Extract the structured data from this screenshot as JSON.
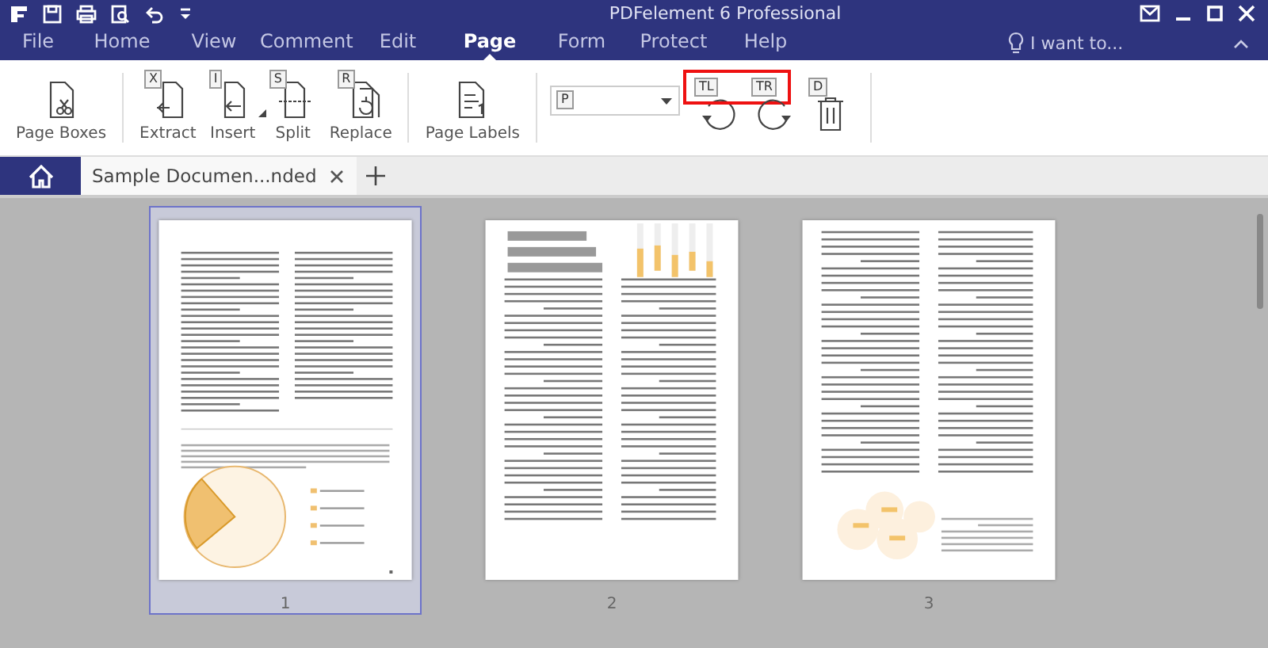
{
  "window": {
    "title": "PDFelement 6 Professional"
  },
  "menu_tabs": [
    {
      "label": "File",
      "selected": false
    },
    {
      "label": "Home",
      "selected": false
    },
    {
      "label": "View",
      "selected": false
    },
    {
      "label": "Comment",
      "selected": false
    },
    {
      "label": "Edit",
      "selected": false
    },
    {
      "label": "Page",
      "selected": true
    },
    {
      "label": "Form",
      "selected": false
    },
    {
      "label": "Protect",
      "selected": false
    },
    {
      "label": "Help",
      "selected": false
    }
  ],
  "search": {
    "placeholder": "I want to..."
  },
  "ribbon": [
    {
      "kind": "tool",
      "label": "Page Boxes"
    },
    {
      "kind": "sep"
    },
    {
      "kind": "tool",
      "label": "Extract",
      "key": "X"
    },
    {
      "kind": "tool",
      "label": "Insert",
      "key": "I",
      "menu": true
    },
    {
      "kind": "tool",
      "label": "Split",
      "key": "S"
    },
    {
      "kind": "tool",
      "label": "Replace",
      "key": "R"
    },
    {
      "kind": "sep"
    },
    {
      "kind": "tool",
      "label": "Page Labels"
    },
    {
      "kind": "sep"
    },
    {
      "kind": "dropdown",
      "key": "P"
    },
    {
      "kind": "icon",
      "key": "TL",
      "highlighted": true
    },
    {
      "kind": "icon",
      "key": "TR",
      "highlighted": true
    },
    {
      "kind": "icon",
      "key": "D"
    },
    {
      "kind": "sep"
    }
  ],
  "doc_tabs": [
    {
      "label": "Sample Documen...nded",
      "selected": true
    }
  ],
  "pages": [
    {
      "label": "1",
      "selected": true,
      "rotated": false
    },
    {
      "label": "2",
      "selected": false,
      "rotated": true
    },
    {
      "label": "3",
      "selected": false,
      "rotated": true
    }
  ]
}
